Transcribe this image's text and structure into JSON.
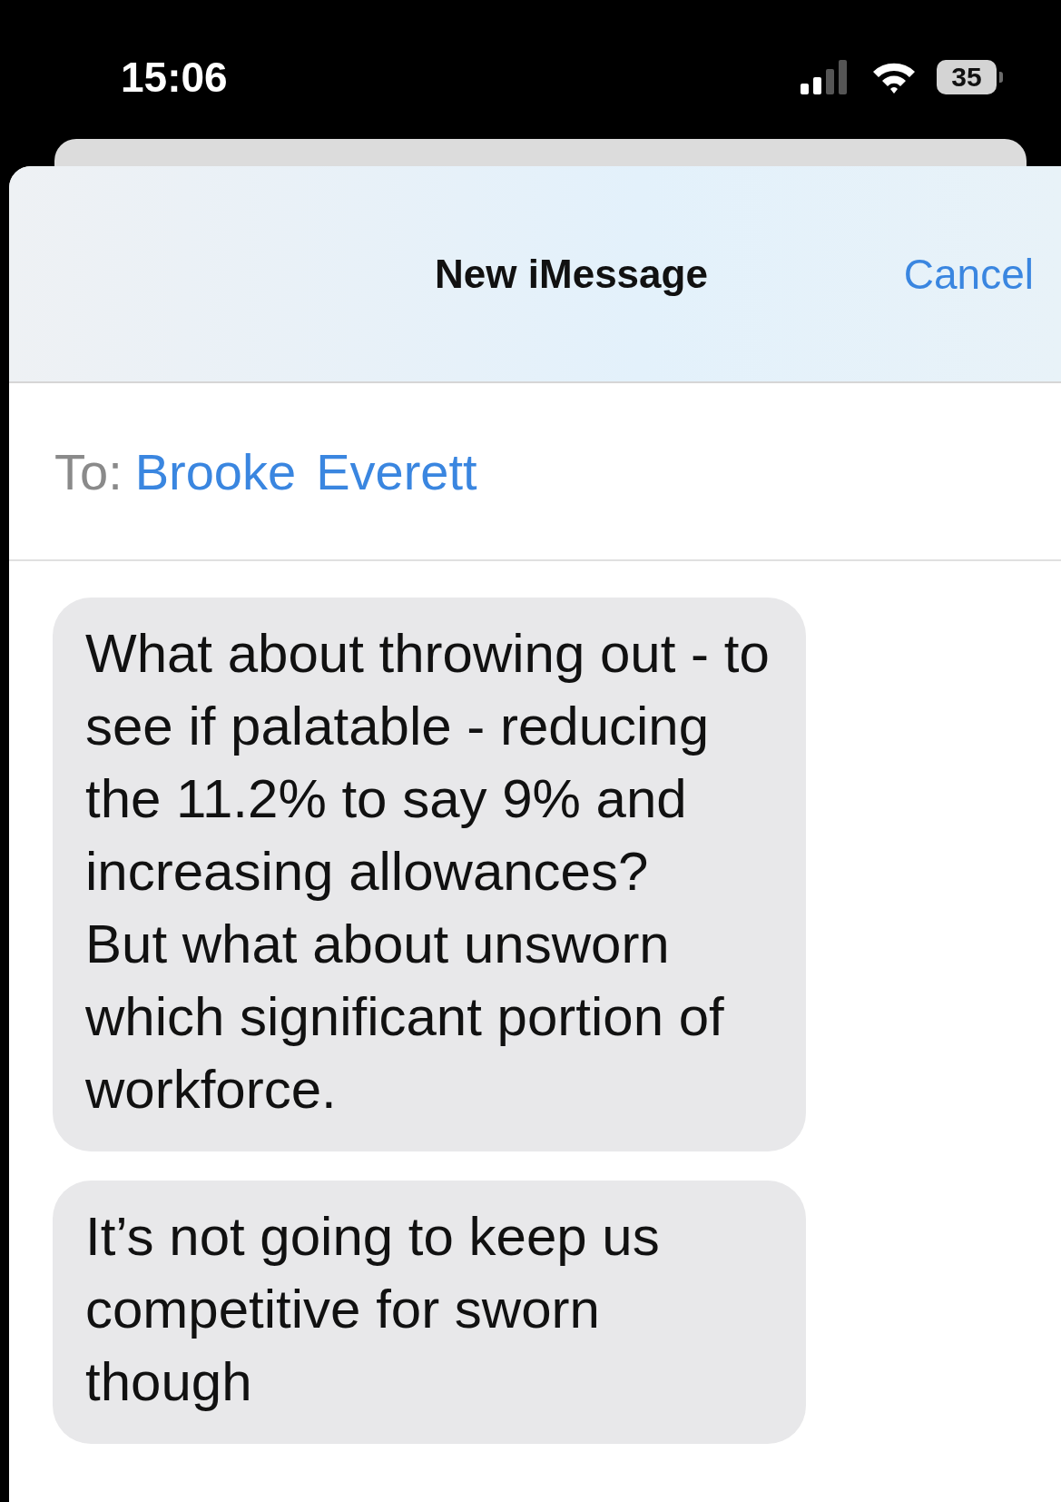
{
  "status_bar": {
    "time": "15:06",
    "battery": "35"
  },
  "header": {
    "title": "New iMessage",
    "cancel": "Cancel"
  },
  "recipient": {
    "label": "To:",
    "names": [
      "Brooke",
      "Everett"
    ]
  },
  "messages": [
    {
      "text": "What about throwing out - to see if palatable - reducing the 11.2% to say 9% and increasing allowances?\nBut what about unsworn which significant portion of workforce."
    },
    {
      "text": "It’s not going to keep us competitive for sworn though"
    }
  ]
}
